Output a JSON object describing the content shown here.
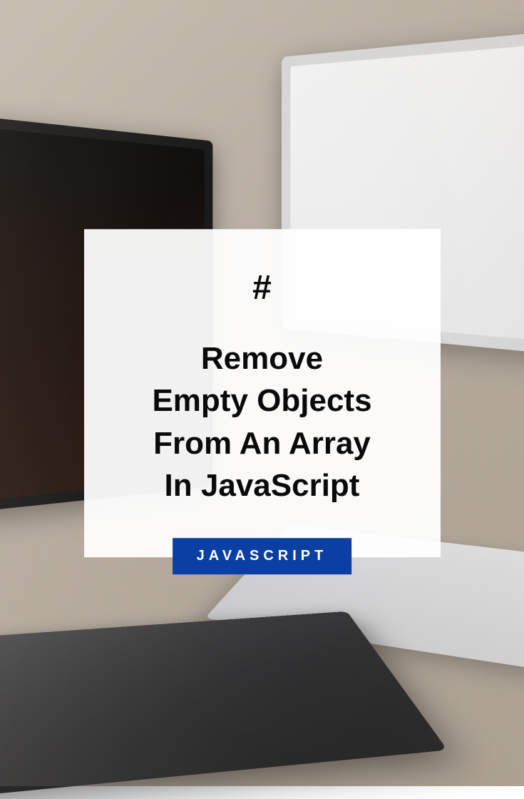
{
  "card": {
    "hash": "#",
    "title_lines": [
      "Remove",
      "Empty Objects",
      "From An Array",
      "In JavaScript"
    ],
    "tag": "JAVASCRIPT"
  },
  "colors": {
    "tag_bg": "#0b3fa3",
    "text": "#0a0a0a",
    "card_bg": "rgba(255,255,255,0.94)"
  }
}
